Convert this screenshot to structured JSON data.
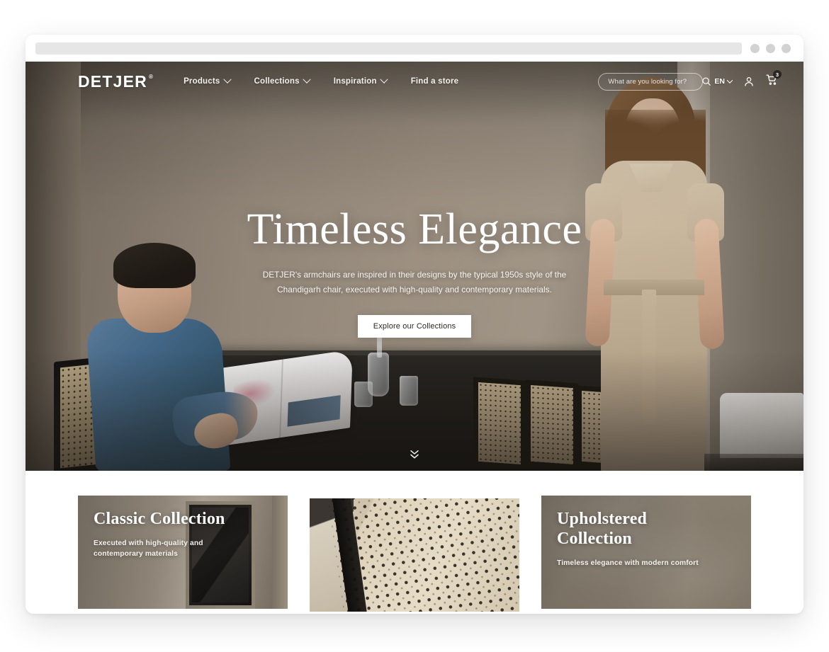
{
  "browser": {
    "url_value": "",
    "url_placeholder": "",
    "dots": [
      "dot-1",
      "dot-2",
      "dot-3"
    ]
  },
  "header": {
    "logo": "DETJER",
    "logo_mark": "®",
    "nav": [
      {
        "label": "Products",
        "has_dropdown": true
      },
      {
        "label": "Collections",
        "has_dropdown": true
      },
      {
        "label": "Inspiration",
        "has_dropdown": true
      },
      {
        "label": "Find a store",
        "has_dropdown": false
      }
    ],
    "search": {
      "placeholder": "What are you looking for?",
      "value": "",
      "icon": "search-icon"
    },
    "language": {
      "selected": "EN",
      "icon": "chevron-down-icon"
    },
    "account": {
      "icon": "user-icon"
    },
    "cart": {
      "icon": "cart-icon",
      "badge_count": "3"
    }
  },
  "hero": {
    "title": "Timeless Elegance",
    "subtitle": "DETJER's armchairs are inspired in their designs by the typical 1950s style of the Chandigarh chair, executed with high-quality and contemporary materials.",
    "cta_label": "Explore our Collections",
    "scroll_cue_icon": "double-chevron-down-icon"
  },
  "collections": {
    "cards": [
      {
        "title": "Classic Collection",
        "description": "Executed with high-quality and contemporary materials",
        "image_subject": "interior room with framed dark artwork"
      },
      {
        "title": "",
        "description": "",
        "image_subject": "close-up of woven cane rattan chair seat"
      },
      {
        "title": "Upholstered Collection",
        "description": "Timeless elegance with modern comfort",
        "image_subject": "soft taupe upholstery fabric"
      }
    ]
  },
  "colors": {
    "page_background": "#ffffff",
    "hero_wall": "#a2958e",
    "hero_text": "#ffffff",
    "cta_background": "#ffffff",
    "cta_text": "#2d2a26",
    "badge_background": "#2a2622",
    "url_bar": "#e6e6e6",
    "window_dot": "#d2d2d2"
  }
}
